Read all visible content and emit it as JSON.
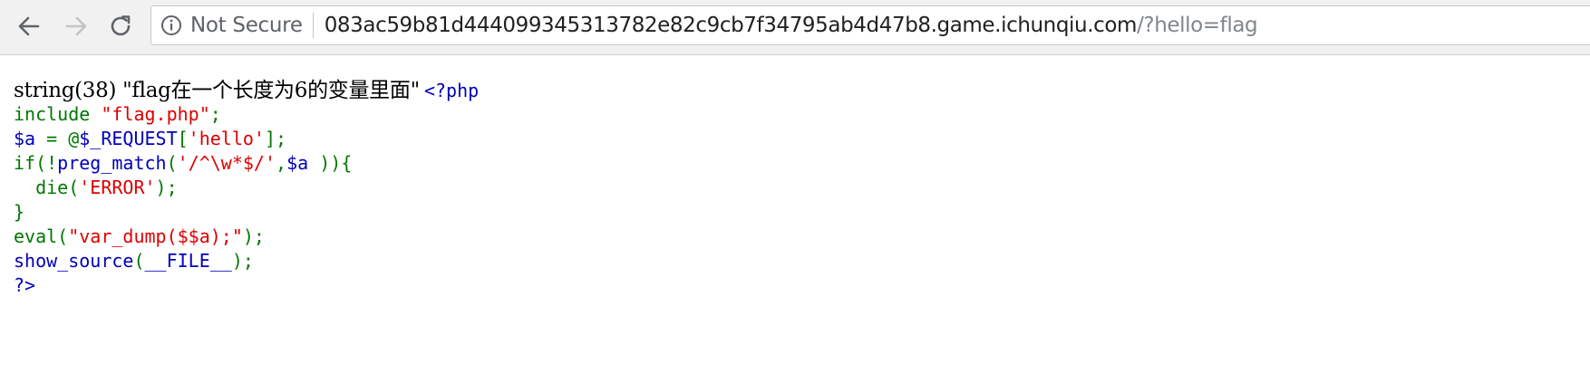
{
  "browser": {
    "security_label": "Not Secure",
    "url_host": "083ac59b81d444099345313782e82c9cb7f34795ab4d47b8.game.ichunqiu.com",
    "url_path": "/?hello=flag",
    "icons": {
      "back": "back-arrow-icon",
      "forward": "forward-arrow-icon",
      "reload": "reload-icon",
      "info": "info-icon"
    }
  },
  "page": {
    "dump_output": "string(38) \"flag在一个长度为6的变量里面\"",
    "source_lines": [
      [
        {
          "t": "<?php",
          "c": "blue"
        }
      ],
      [
        {
          "t": "include ",
          "c": "green"
        },
        {
          "t": "\"flag.php\"",
          "c": "red"
        },
        {
          "t": ";",
          "c": "green"
        }
      ],
      [
        {
          "t": "$a ",
          "c": "blue"
        },
        {
          "t": "= @",
          "c": "green"
        },
        {
          "t": "$_REQUEST",
          "c": "blue"
        },
        {
          "t": "[",
          "c": "green"
        },
        {
          "t": "'hello'",
          "c": "red"
        },
        {
          "t": "];",
          "c": "green"
        }
      ],
      [
        {
          "t": "if(!",
          "c": "green"
        },
        {
          "t": "preg_match",
          "c": "blue"
        },
        {
          "t": "(",
          "c": "green"
        },
        {
          "t": "'/^\\w*$/'",
          "c": "red"
        },
        {
          "t": ",",
          "c": "green"
        },
        {
          "t": "$a ",
          "c": "blue"
        },
        {
          "t": ")){",
          "c": "green"
        }
      ],
      [
        {
          "t": "  die(",
          "c": "green"
        },
        {
          "t": "'ERROR'",
          "c": "red"
        },
        {
          "t": ");",
          "c": "green"
        }
      ],
      [
        {
          "t": "}",
          "c": "green"
        }
      ],
      [
        {
          "t": "eval(",
          "c": "green"
        },
        {
          "t": "\"var_dump($$a);\"",
          "c": "red"
        },
        {
          "t": ");",
          "c": "green"
        }
      ],
      [
        {
          "t": "show_source",
          "c": "blue"
        },
        {
          "t": "(",
          "c": "green"
        },
        {
          "t": "__FILE__",
          "c": "blue"
        },
        {
          "t": ");",
          "c": "green"
        }
      ],
      [
        {
          "t": "?>",
          "c": "blue"
        }
      ]
    ]
  },
  "colors": {
    "blue": "#0000bb",
    "green": "#007700",
    "red": "#dd0000"
  }
}
